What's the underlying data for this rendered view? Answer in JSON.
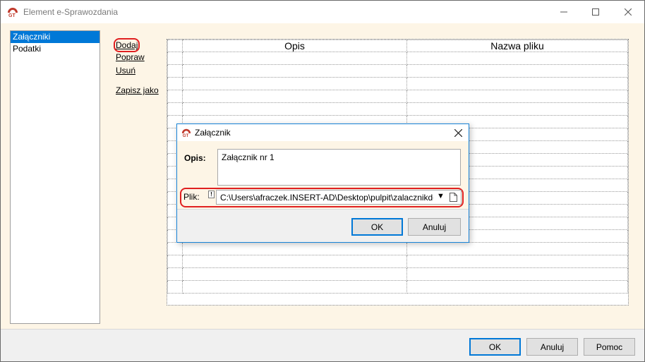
{
  "window": {
    "title": "Element e-Sprawozdania"
  },
  "sidebar": {
    "items": [
      {
        "label": "Załączniki",
        "selected": true
      },
      {
        "label": "Podatki",
        "selected": false
      }
    ]
  },
  "actions": {
    "add": "Dodaj",
    "edit": "Popraw",
    "delete": "Usuń",
    "save_as": "Zapisz jako"
  },
  "grid": {
    "columns": [
      "Opis",
      "Nazwa pliku"
    ],
    "rows": []
  },
  "footer": {
    "ok": "OK",
    "cancel": "Anuluj",
    "help": "Pomoc"
  },
  "dialog": {
    "title": "Załącznik",
    "opis_label": "Opis:",
    "opis_value": "Załącznik nr 1",
    "plik_label": "Plik:",
    "plik_value": "C:\\Users\\afraczek.INSERT-AD\\Desktop\\pulpit\\zalacznikdosprawozdania",
    "ok": "OK",
    "cancel": "Anuluj"
  },
  "colors": {
    "accent": "#0078d7",
    "highlight": "#e02020",
    "panel": "#fdf5e6"
  }
}
